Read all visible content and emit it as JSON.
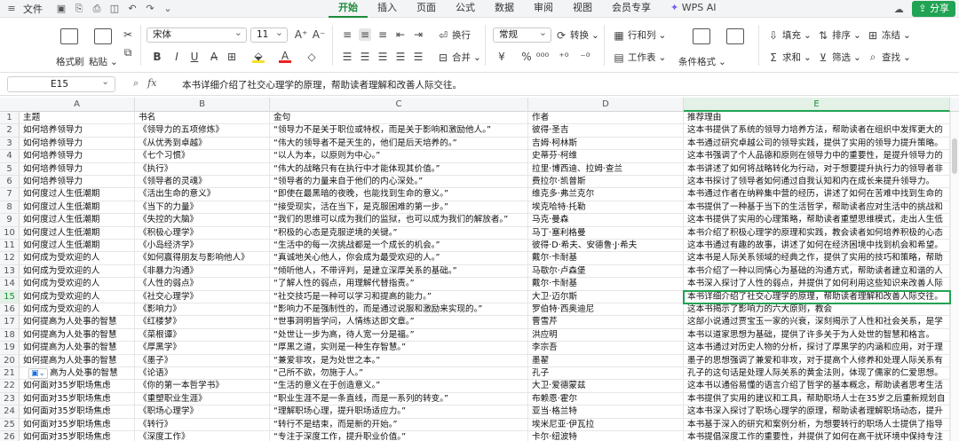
{
  "menubar": {
    "file_label": "文件",
    "tabs": [
      "开始",
      "插入",
      "页面",
      "公式",
      "数据",
      "审阅",
      "视图",
      "会员专享"
    ],
    "ai_label": "WPS AI",
    "share_label": "分享"
  },
  "ribbon": {
    "format_painter": "格式刷",
    "paste": "粘贴",
    "font_name": "宋体",
    "font_size": "11",
    "wrap": "换行",
    "merge": "合并",
    "number_format": "常规",
    "convert": "转换",
    "row_col": "行和列",
    "worksheet": "工作表",
    "cond_format": "条件格式",
    "fill": "填充",
    "sort": "排序",
    "freeze": "冻结",
    "sum": "求和",
    "filter": "筛选",
    "find": "查找"
  },
  "formula_bar": {
    "cell_ref": "E15",
    "content": "本书详细介绍了社交心理学的原理，帮助读者理解和改善人际交往。"
  },
  "sheet": {
    "columns": [
      "A",
      "B",
      "C",
      "D",
      "E"
    ],
    "selected_column": "E",
    "selected_row": 15,
    "rows": [
      [
        "主题",
        "书名",
        "金句",
        "作者",
        "推荐理由"
      ],
      [
        "如何培养领导力",
        "《领导力的五项修炼》",
        "“领导力不是关于职位或特权，而是关于影响和激励他人。”",
        "彼得·圣吉",
        "这本书提供了系统的领导力培养方法，帮助读者在组织中发挥更大的"
      ],
      [
        "如何培养领导力",
        "《从优秀到卓越》",
        "“伟大的领导者不是天生的，他们是后天培养的。”",
        "吉姆·柯林斯",
        "本书通过研究卓越公司的领导实践，提供了实用的领导力提升策略。"
      ],
      [
        "如何培养领导力",
        "《七个习惯》",
        "“以人为本，以原则为中心。”",
        "史蒂芬·柯维",
        "这本书强调了个人品德和原则在领导力中的重要性，是提升领导力的"
      ],
      [
        "如何培养领导力",
        "《执行》",
        "“伟大的战略只有在执行中才能体现其价值。”",
        "拉里·博西迪、拉姆·查兰",
        "本书讲述了如何将战略转化为行动，对于想要提升执行力的领导者非"
      ],
      [
        "如何培养领导力",
        "《领导者的灵魂》",
        "“领导者的力量来自于他们的内心深处。”",
        "费拉尔·凯普斯",
        "这本书探讨了领导者如何通过自我认知和内在成长来提升领导力。"
      ],
      [
        "如何度过人生低潮期",
        "《活出生命的意义》",
        "“即使在最黑暗的夜晚，也能找到生命的意义。”",
        "维克多·弗兰克尔",
        "本书通过作者在纳粹集中营的经历，讲述了如何在苦难中找到生命的"
      ],
      [
        "如何度过人生低潮期",
        "《当下的力量》",
        "“接受现实，活在当下，是克服困难的第一步。”",
        "埃克哈特·托勒",
        "本书提供了一种基于当下的生活哲学，帮助读者应对生活中的挑战和"
      ],
      [
        "如何度过人生低潮期",
        "《失控的大脑》",
        "“我们的思维可以成为我们的监狱，也可以成为我们的解放者。”",
        "马克·曼森",
        "这本书提供了实用的心理策略，帮助读者重塑思维模式，走出人生低"
      ],
      [
        "如何度过人生低潮期",
        "《积极心理学》",
        "“积极的心态是克服逆境的关键。”",
        "马丁·塞利格曼",
        "本书介绍了积极心理学的原理和实践，教会读者如何培养积极的心态"
      ],
      [
        "如何度过人生低潮期",
        "《小岛经济学》",
        "“生活中的每一次挑战都是一个成长的机会。”",
        "彼得·D·希夫、安德鲁·J·希夫",
        "这本书通过有趣的故事，讲述了如何在经济困境中找到机会和希望。"
      ],
      [
        "如何成为受欢迎的人",
        "《如何赢得朋友与影响他人》",
        "“真诚地关心他人，你会成为最受欢迎的人。”",
        "戴尔·卡耐基",
        "这本书是人际关系领域的经典之作，提供了实用的技巧和策略，帮助"
      ],
      [
        "如何成为受欢迎的人",
        "《非暴力沟通》",
        "“倾听他人，不带评判，是建立深厚关系的基础。”",
        "马歇尔·卢森堡",
        "本书介绍了一种以同情心为基础的沟通方式，帮助读者建立和谐的人"
      ],
      [
        "如何成为受欢迎的人",
        "《人性的弱点》",
        "“了解人性的弱点，用理解代替指责。”",
        "戴尔·卡耐基",
        "本书深入探讨了人性的弱点，并提供了如何利用这些知识来改善人际"
      ],
      [
        "如何成为受欢迎的人",
        "《社交心理学》",
        "“社交技巧是一种可以学习和提高的能力。”",
        "大卫·迈尔斯",
        "本书详细介绍了社交心理学的原理，帮助读者理解和改善人际交往。"
      ],
      [
        "如何成为受欢迎的人",
        "《影响力》",
        "“影响力不是强制性的，而是通过说服和激励来实现的。”",
        "罗伯特·西奥迪尼",
        "这本书揭示了影响力的六大原则，教会"
      ],
      [
        "如何提高为人处事的智慧",
        "《红楼梦》",
        "“世事洞明皆学问，人情练达即文章。”",
        "曹雪芹",
        "这部小说通过贾宝玉一家的兴衰，深刻揭示了人性和社会关系，是学"
      ],
      [
        "如何提高为人处事的智慧",
        "《菜根谭》",
        "“处世让一步为高，待人宽一分是福。”",
        "洪应明",
        "本书以道家思想为基础，提供了许多关于为人处世的智慧和格言。"
      ],
      [
        "如何提高为人处事的智慧",
        "《厚黑学》",
        "“厚黑之道，实则是一种生存智慧。”",
        "李宗吾",
        "这本书通过对历史人物的分析，探讨了厚黑学的内涵和应用，对于理"
      ],
      [
        "如何提高为人处事的智慧",
        "《墨子》",
        "“兼爱非攻，是为处世之本。”",
        "墨翟",
        "墨子的思想强调了兼爱和非攻，对于提高个人修养和处理人际关系有"
      ],
      [
        "高为人处事的智慧",
        "《论语》",
        "“己所不欲，勿施于人。”",
        "孔子",
        "孔子的这句话是处理人际关系的黄金法则，体现了儒家的仁爱思想。"
      ],
      [
        "如何面对35岁职场焦虑",
        "《你的第一本哲学书》",
        "“生活的意义在于创造意义。”",
        "大卫·爱德蒙兹",
        "这本书以通俗易懂的语言介绍了哲学的基本概念，帮助读者思考生活"
      ],
      [
        "如何面对35岁职场焦虑",
        "《重塑职业生涯》",
        "“职业生涯不是一条直线，而是一系列的转变。”",
        "布赖恩·霍尔",
        "本书提供了实用的建议和工具，帮助职场人士在35岁之后重新规划自"
      ],
      [
        "如何面对35岁职场焦虑",
        "《职场心理学》",
        "“理解职场心理，提升职场适应力。”",
        "亚当·格兰特",
        "这本书深入探讨了职场心理学的原理，帮助读者理解职场动态，提升"
      ],
      [
        "如何面对35岁职场焦虑",
        "《转行》",
        "“转行不是结束，而是新的开始。”",
        "埃米尼亚·伊瓦拉",
        "本书基于深入的研究和案例分析，为想要转行的职场人士提供了指导"
      ],
      [
        "如何面对35岁职场焦虑",
        "《深度工作》",
        "“专注于深度工作，提升职业价值。”",
        "卡尔·纽波特",
        "本书提倡深度工作的重要性，并提供了如何在高干扰环境中保持专注"
      ]
    ]
  }
}
